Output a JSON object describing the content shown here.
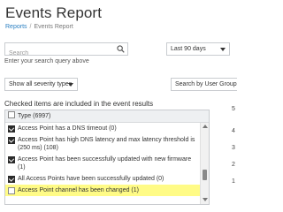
{
  "header": {
    "title": "Events Report",
    "breadcrumb": {
      "link": "Reports",
      "separator": "/",
      "current": "Events Report"
    }
  },
  "search": {
    "placeholder": "Search",
    "value": "",
    "hint": "Enter your search query above"
  },
  "date_range": {
    "selected": "Last 90 days"
  },
  "severity": {
    "selected": "Show all severity types"
  },
  "group_by": {
    "selected": "Search by User Group"
  },
  "checked_note": "Checked items are included in the event results",
  "types_panel": {
    "header": {
      "label": "Type (6997)",
      "checked": false
    },
    "items": [
      {
        "label": "Access Point has a DNS timeout (0)",
        "checked": true,
        "highlighted": false
      },
      {
        "label": "Access Point has high DNS latency and max latency threshold is (250 ms) (108)",
        "checked": true,
        "highlighted": false
      },
      {
        "label": "Access Point has been successfully updated with new firmware (1)",
        "checked": true,
        "highlighted": false
      },
      {
        "label": "All Access Points have been successfully updated (0)",
        "checked": true,
        "highlighted": false
      },
      {
        "label": "Access Point channel has been changed (1)",
        "checked": false,
        "highlighted": true
      }
    ]
  },
  "edge_values": [
    "5",
    "4",
    "3",
    "2",
    "1"
  ]
}
